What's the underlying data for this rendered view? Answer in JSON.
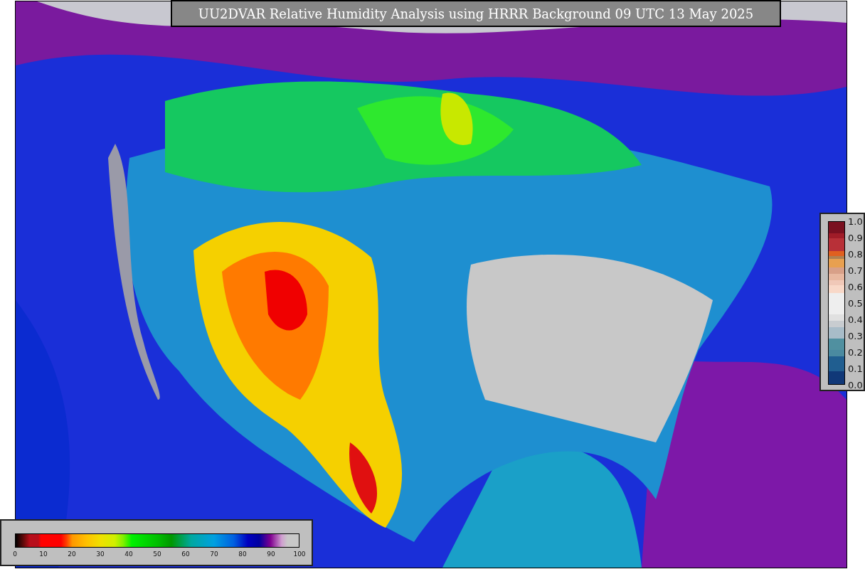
{
  "title": "UU2DVAR Relative Humidity Analysis using HRRR Background 09 UTC 13 May 2025",
  "humidity_colorbar": {
    "ticks": [
      "0",
      "10",
      "20",
      "30",
      "40",
      "50",
      "60",
      "70",
      "80",
      "90",
      "100"
    ]
  },
  "station_colorbar": {
    "ticks": [
      "1.0",
      "0.9",
      "0.8",
      "0.7",
      "0.6",
      "0.5",
      "0.4",
      "0.3",
      "0.2",
      "0.1",
      "0.0"
    ]
  }
}
